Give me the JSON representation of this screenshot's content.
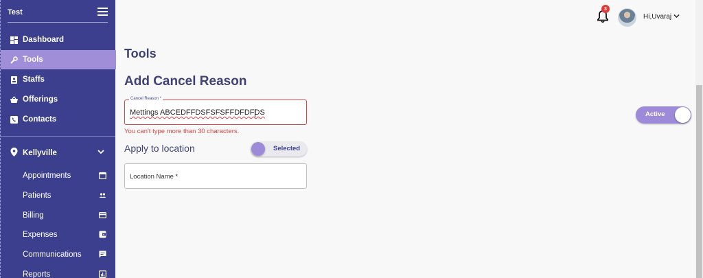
{
  "sidebar": {
    "title": "Test",
    "nav": [
      {
        "label": "Dashboard",
        "icon": "dashboard-icon"
      },
      {
        "label": "Tools",
        "icon": "wrench-icon",
        "active": true
      },
      {
        "label": "Staffs",
        "icon": "badge-icon"
      },
      {
        "label": "Offerings",
        "icon": "basket-icon"
      },
      {
        "label": "Contacts",
        "icon": "phone-icon"
      }
    ],
    "location": {
      "label": "Kellyville",
      "icon": "location-pin-icon"
    },
    "sub_items": [
      {
        "label": "Appointments",
        "icon": "calendar-icon"
      },
      {
        "label": "Patients",
        "icon": "people-icon"
      },
      {
        "label": "Billing",
        "icon": "credit-card-icon"
      },
      {
        "label": "Expenses",
        "icon": "wallet-icon"
      },
      {
        "label": "Communications",
        "icon": "chat-icon"
      },
      {
        "label": "Reports",
        "icon": "report-icon"
      }
    ]
  },
  "header": {
    "notification_count": "3",
    "user_greeting": "Hi,Uvaraj"
  },
  "main": {
    "page_title": "Tools",
    "section_title": "Add Cancel Reason",
    "cancel_reason": {
      "label": "Cancel Reason *",
      "value": "Mettings ABCEDFFDSFSFSFFDFDFDS",
      "error": "You can't type more than 30 characters."
    },
    "apply_to_location_label": "Apply to location",
    "apply_toggle_label": "Selected",
    "location_field_placeholder": "Location Name *",
    "status_toggle_label": "Active"
  },
  "colors": {
    "sidebar_bg": "#3c3f8e",
    "active_item": "#a08ed9",
    "accent": "#9d8ad8",
    "error": "#d64545",
    "heading": "#3f4275"
  }
}
